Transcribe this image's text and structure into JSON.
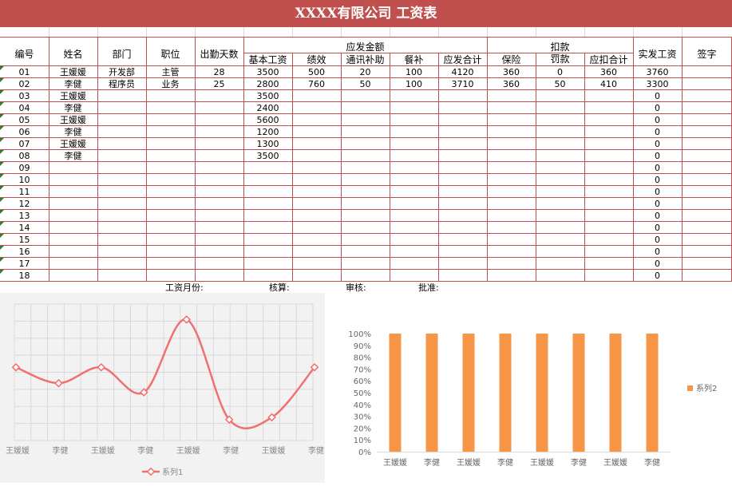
{
  "title": "XXXX有限公司  工资表",
  "table": {
    "headers": {
      "id": "编号",
      "name": "姓名",
      "dept": "部门",
      "position": "职位",
      "days": "出勤天数",
      "payable_group": "应发金额",
      "base": "基本工资",
      "perf": "绩效",
      "comm": "通讯补助",
      "meal": "餐补",
      "payable_total": "应发合计",
      "deduct_group": "扣款",
      "insurance": "保险",
      "fine": "罚款",
      "deduct_total": "应扣合计",
      "net": "实发工资",
      "sign": "签字"
    },
    "rows": [
      {
        "id": "01",
        "name": "王媛媛",
        "dept": "开发部",
        "position": "主管",
        "days": "28",
        "base": "3500",
        "perf": "500",
        "comm": "20",
        "meal": "100",
        "payable_total": "4120",
        "insurance": "360",
        "fine": "0",
        "deduct_total": "360",
        "net": "3760"
      },
      {
        "id": "02",
        "name": "李健",
        "dept": "程序员",
        "position": "业务",
        "days": "25",
        "base": "2800",
        "perf": "760",
        "comm": "50",
        "meal": "100",
        "payable_total": "3710",
        "insurance": "360",
        "fine": "50",
        "deduct_total": "410",
        "net": "3300"
      },
      {
        "id": "03",
        "name": "王媛媛",
        "base": "3500",
        "net": "0"
      },
      {
        "id": "04",
        "name": "李健",
        "base": "2400",
        "net": "0"
      },
      {
        "id": "05",
        "name": "王媛媛",
        "base": "5600",
        "net": "0"
      },
      {
        "id": "06",
        "name": "李健",
        "base": "1200",
        "net": "0"
      },
      {
        "id": "07",
        "name": "王媛媛",
        "base": "1300",
        "net": "0"
      },
      {
        "id": "08",
        "name": "李健",
        "base": "3500",
        "net": "0"
      },
      {
        "id": "09",
        "net": "0"
      },
      {
        "id": "10",
        "net": "0"
      },
      {
        "id": "11",
        "net": "0"
      },
      {
        "id": "12",
        "net": "0"
      },
      {
        "id": "13",
        "net": "0"
      },
      {
        "id": "14",
        "net": "0"
      },
      {
        "id": "15",
        "net": "0"
      },
      {
        "id": "16",
        "net": "0"
      },
      {
        "id": "17",
        "net": "0"
      },
      {
        "id": "18",
        "net": "0"
      }
    ]
  },
  "footer": {
    "month": "工资月份:",
    "check": "核算:",
    "review": "审核:",
    "approve": "批准:"
  },
  "colors": {
    "header": "#c0504d",
    "grid": "#c0504d",
    "line_series": "#f07070",
    "bar_series": "#f79646"
  },
  "chart_data": [
    {
      "type": "line",
      "categories": [
        "王媛媛",
        "李健",
        "王媛媛",
        "李健",
        "王媛媛",
        "李健",
        "王媛媛",
        "李健"
      ],
      "series": [
        {
          "name": "系列1",
          "values": [
            3500,
            2800,
            3500,
            2400,
            5600,
            1200,
            1300,
            3500
          ]
        }
      ],
      "ylim": [
        0,
        6000
      ],
      "grid": true,
      "legend": "bottom"
    },
    {
      "type": "bar",
      "categories": [
        "王媛媛",
        "李健",
        "王媛媛",
        "李健",
        "王媛媛",
        "李健",
        "王媛媛",
        "李健"
      ],
      "series": [
        {
          "name": "系列2",
          "values": [
            100,
            100,
            100,
            100,
            100,
            100,
            100,
            100
          ]
        }
      ],
      "yticks": [
        "0%",
        "10%",
        "20%",
        "30%",
        "40%",
        "50%",
        "60%",
        "70%",
        "80%",
        "90%",
        "100%"
      ],
      "ylim": [
        0,
        100
      ],
      "grid": false,
      "legend": "right"
    }
  ]
}
